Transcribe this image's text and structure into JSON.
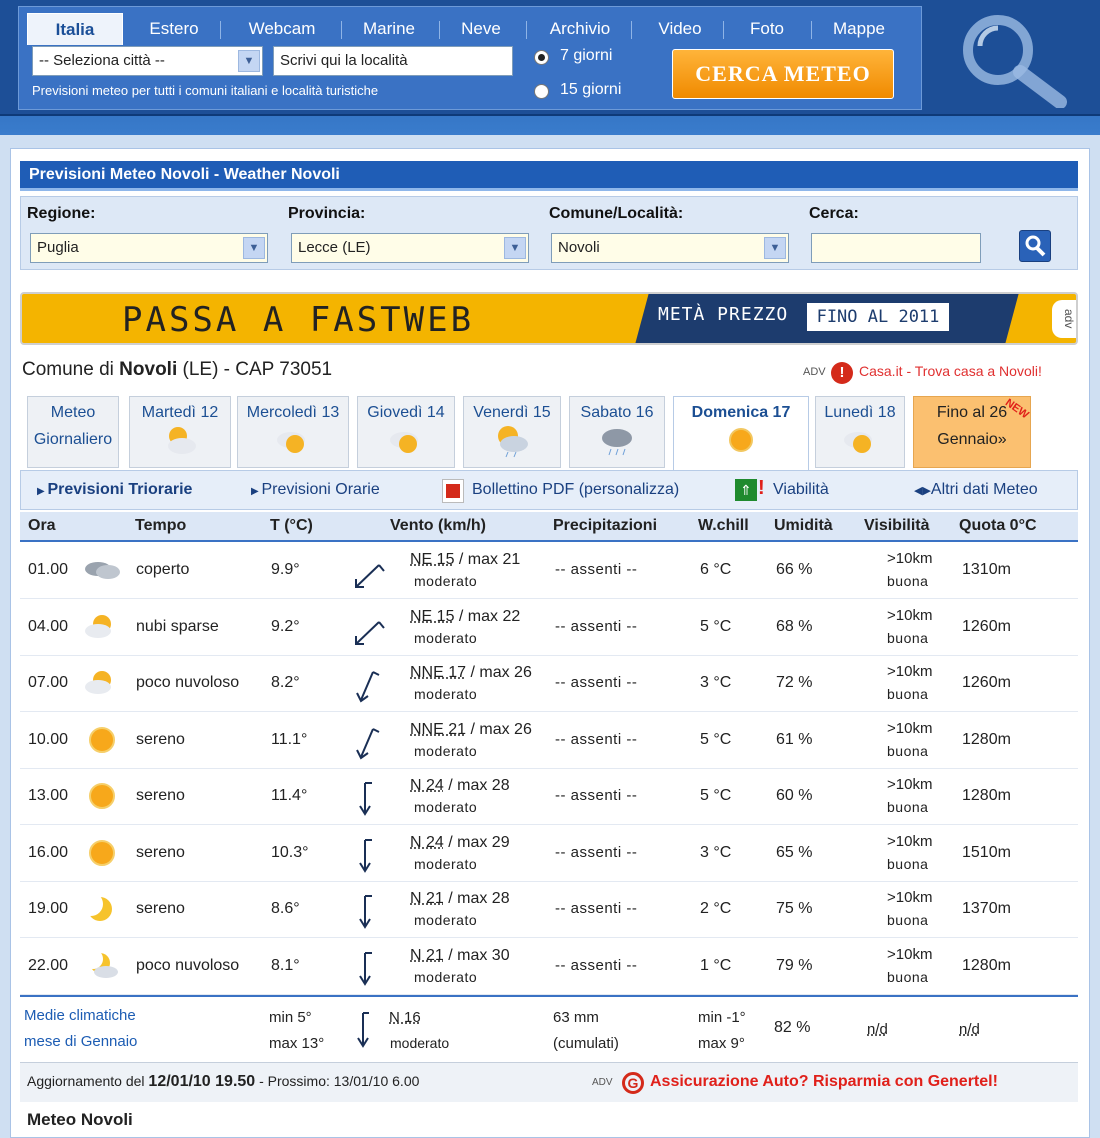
{
  "nav": {
    "tabs": [
      "Italia",
      "Estero",
      "Webcam",
      "Marine",
      "Neve",
      "Archivio",
      "Video",
      "Foto",
      "Mappe"
    ],
    "city_select": "-- Seleziona città --",
    "place_placeholder": "Scrivi qui la località",
    "subtitle": "Previsioni meteo per tutti i comuni italiani e località turistiche",
    "radio_7": "7 giorni",
    "radio_15": "15 giorni",
    "search_button": "CERCA METEO"
  },
  "page": {
    "title": "Previsioni Meteo Novoli - Weather Novoli"
  },
  "filters": {
    "regione_label": "Regione:",
    "regione_value": "Puglia",
    "provincia_label": "Provincia:",
    "provincia_value": "Lecce (LE)",
    "comune_label": "Comune/Località:",
    "comune_value": "Novoli",
    "cerca_label": "Cerca:"
  },
  "banner": {
    "left": "PASSA A FASTWEB",
    "mid": "METÀ PREZZO",
    "right": "FINO AL 2011",
    "adv": "adv"
  },
  "comune": {
    "prefix": "Comune di ",
    "name": "Novoli",
    "suffix": " (LE) - CAP 73051",
    "adv": "ADV",
    "ad_text": "Casa.it - Trova casa a Novoli!"
  },
  "day_tabs": [
    {
      "l1": "Meteo",
      "l2": "Giornaliero"
    },
    {
      "l1": "Martedì 12"
    },
    {
      "l1": "Mercoledì 13"
    },
    {
      "l1": "Giovedì 14"
    },
    {
      "l1": "Venerdì 15"
    },
    {
      "l1": "Sabato 16"
    },
    {
      "l1": "Domenica 17"
    },
    {
      "l1": "Lunedì 18"
    },
    {
      "l1": "Fino al 26",
      "l2": "Gennaio»",
      "badge": "NEW"
    }
  ],
  "subnav": {
    "triorarie": "Previsioni Triorarie",
    "orarie": "Previsioni Orarie",
    "pdf": "Bollettino PDF (personalizza)",
    "viabilita": "Viabilità",
    "altri": "Altri dati Meteo"
  },
  "table": {
    "headers": [
      "Ora",
      "Tempo",
      "T (°C)",
      "Vento (km/h)",
      "Precipitazioni",
      "W.chill",
      "Umidità",
      "Visibilità",
      "Quota 0°C"
    ],
    "rows": [
      {
        "ora": "01.00",
        "icon": "cloud-icon",
        "tempo": "coperto",
        "t": "9.9°",
        "dir": "NE 15",
        "max": " / max 21",
        "forza": "moderato",
        "precip": "-- assenti --",
        "wc": "6 °C",
        "um": "66 %",
        "vis": ">10km",
        "vis2": "buona",
        "q": "1310m"
      },
      {
        "ora": "04.00",
        "icon": "sun-cloud-icon",
        "tempo": "nubi sparse",
        "t": "9.2°",
        "dir": "NE 15",
        "max": " / max 22",
        "forza": "moderato",
        "precip": "-- assenti --",
        "wc": "5 °C",
        "um": "68 %",
        "vis": ">10km",
        "vis2": "buona",
        "q": "1260m"
      },
      {
        "ora": "07.00",
        "icon": "sun-cloud-icon",
        "tempo": "poco nuvoloso",
        "t": "8.2°",
        "dir": "NNE 17",
        "max": " / max 26",
        "forza": "moderato",
        "precip": "-- assenti --",
        "wc": "3 °C",
        "um": "72 %",
        "vis": ">10km",
        "vis2": "buona",
        "q": "1260m"
      },
      {
        "ora": "10.00",
        "icon": "sun-icon",
        "tempo": "sereno",
        "t": "11.1°",
        "dir": "NNE 21",
        "max": " / max 26",
        "forza": "moderato",
        "precip": "-- assenti --",
        "wc": "5 °C",
        "um": "61 %",
        "vis": ">10km",
        "vis2": "buona",
        "q": "1280m"
      },
      {
        "ora": "13.00",
        "icon": "sun-icon",
        "tempo": "sereno",
        "t": "11.4°",
        "dir": "N 24",
        "max": " / max 28",
        "forza": "moderato",
        "precip": "-- assenti --",
        "wc": "5 °C",
        "um": "60 %",
        "vis": ">10km",
        "vis2": "buona",
        "q": "1280m"
      },
      {
        "ora": "16.00",
        "icon": "sun-icon",
        "tempo": "sereno",
        "t": "10.3°",
        "dir": "N 24",
        "max": " / max 29",
        "forza": "moderato",
        "precip": "-- assenti --",
        "wc": "3 °C",
        "um": "65 %",
        "vis": ">10km",
        "vis2": "buona",
        "q": "1510m"
      },
      {
        "ora": "19.00",
        "icon": "moon-icon",
        "tempo": "sereno",
        "t": "8.6°",
        "dir": "N 21",
        "max": " / max 28",
        "forza": "moderato",
        "precip": "-- assenti --",
        "wc": "2 °C",
        "um": "75 %",
        "vis": ">10km",
        "vis2": "buona",
        "q": "1370m"
      },
      {
        "ora": "22.00",
        "icon": "moon-cloud-icon",
        "tempo": "poco nuvoloso",
        "t": "8.1°",
        "dir": "N 21",
        "max": " / max 30",
        "forza": "moderato",
        "precip": "-- assenti --",
        "wc": "1 °C",
        "um": "79 %",
        "vis": ">10km",
        "vis2": "buona",
        "q": "1280m"
      }
    ]
  },
  "avg": {
    "l1": "Medie climatiche",
    "l2": "mese di Gennaio",
    "tmin": "min 5°",
    "tmax": "max 13°",
    "wind": "N 16",
    "wind2": "moderato",
    "pr": "63 mm",
    "pr2": "(cumulati)",
    "wcmin": "min -1°",
    "wcmax": "max 9°",
    "um": "82 %",
    "vis": "n/d",
    "q": "n/d"
  },
  "update": {
    "prefix": "Aggiornamento del ",
    "date": "12/01/10 19.50",
    "mid": " - Prossimo: 13/01/10 6.00",
    "adv": "ADV",
    "ad": "Assicurazione Auto? Risparmia con Genertel!"
  },
  "footer": {
    "title": "Meteo Novoli"
  }
}
